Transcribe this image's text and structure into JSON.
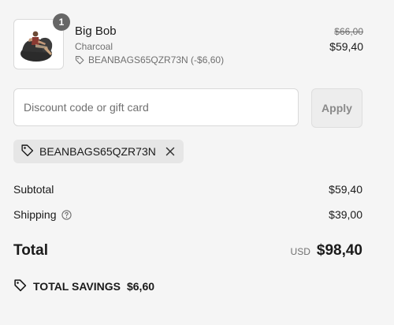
{
  "cart": {
    "items": [
      {
        "quantity": "1",
        "name": "Big Bob",
        "variant": "Charcoal",
        "discount_code_line": "BEANBAGS65QZR73N (-$6,60)",
        "original_price": "$66,00",
        "price": "$59,40",
        "image_alt": "Person sitting on a charcoal bean bag chair",
        "tag_icon": "tag-icon"
      }
    ]
  },
  "discount": {
    "placeholder": "Discount code or gift card",
    "value": "",
    "apply_label": "Apply",
    "applied_code": "BEANBAGS65QZR73N",
    "tag_icon": "tag-icon",
    "remove_icon": "close-icon"
  },
  "summary": {
    "subtotal_label": "Subtotal",
    "subtotal_value": "$59,40",
    "shipping_label": "Shipping",
    "shipping_help_icon": "question-circle-icon",
    "shipping_value": "$39,00",
    "total_label": "Total",
    "total_currency": "USD",
    "total_value": "$98,40",
    "savings_label": "TOTAL SAVINGS",
    "savings_value": "$6,60",
    "savings_icon": "tag-icon"
  },
  "colors": {
    "page_background": "#f5f5f5",
    "text_primary": "#1a1a1a",
    "text_secondary": "#707070",
    "badge_background": "#666666",
    "chip_background": "#e6e6e6",
    "apply_disabled_background": "#ededed",
    "border": "#d9d9d9"
  }
}
